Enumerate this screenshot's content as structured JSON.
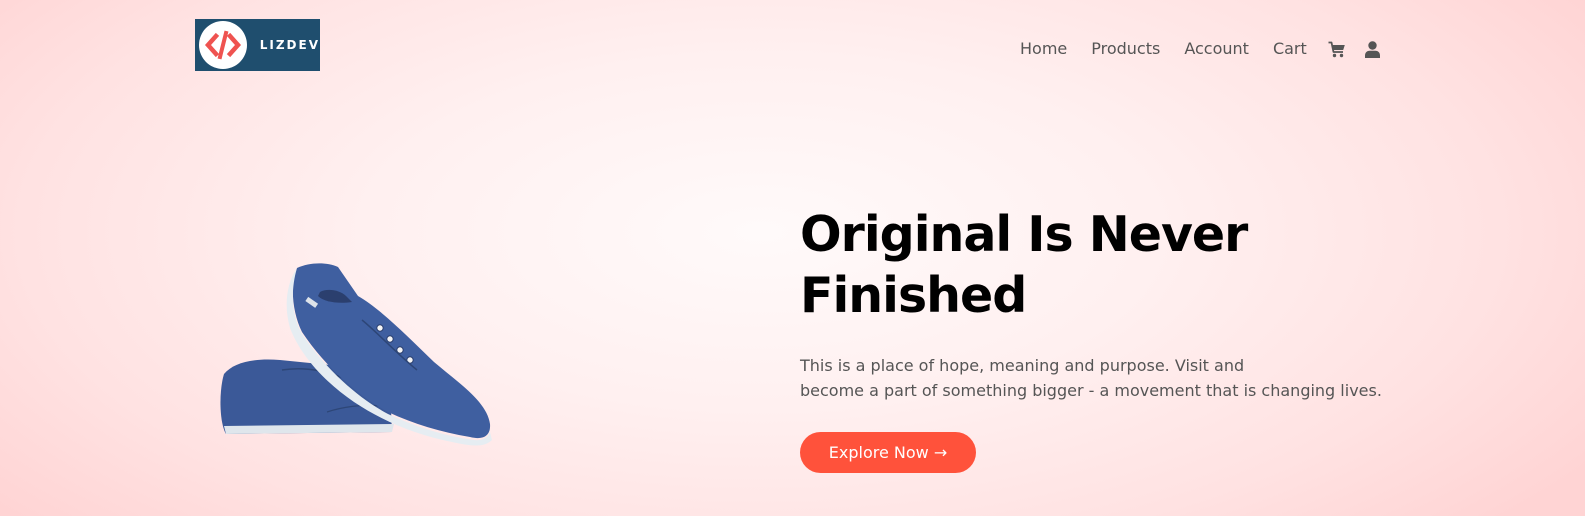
{
  "brand": {
    "name": "LIZDEV",
    "logo_icon": "code-brackets-icon",
    "logo_bg_color": "#1f4e6e",
    "logo_accent_color": "#ef5350"
  },
  "nav": {
    "items": [
      {
        "label": "Home"
      },
      {
        "label": "Products"
      },
      {
        "label": "Account"
      },
      {
        "label": "Cart"
      }
    ],
    "icons": [
      "cart-icon",
      "user-icon"
    ]
  },
  "hero": {
    "title_line1": "Original Is Never",
    "title_line2": "Finished",
    "description_line1": "This is a place of hope, meaning and purpose. Visit and",
    "description_line2": "become a part of something bigger - a movement that is changing lives.",
    "cta_label": "Explore Now →",
    "cta_color": "#ff523b",
    "image": "blue-canvas-sneakers"
  }
}
